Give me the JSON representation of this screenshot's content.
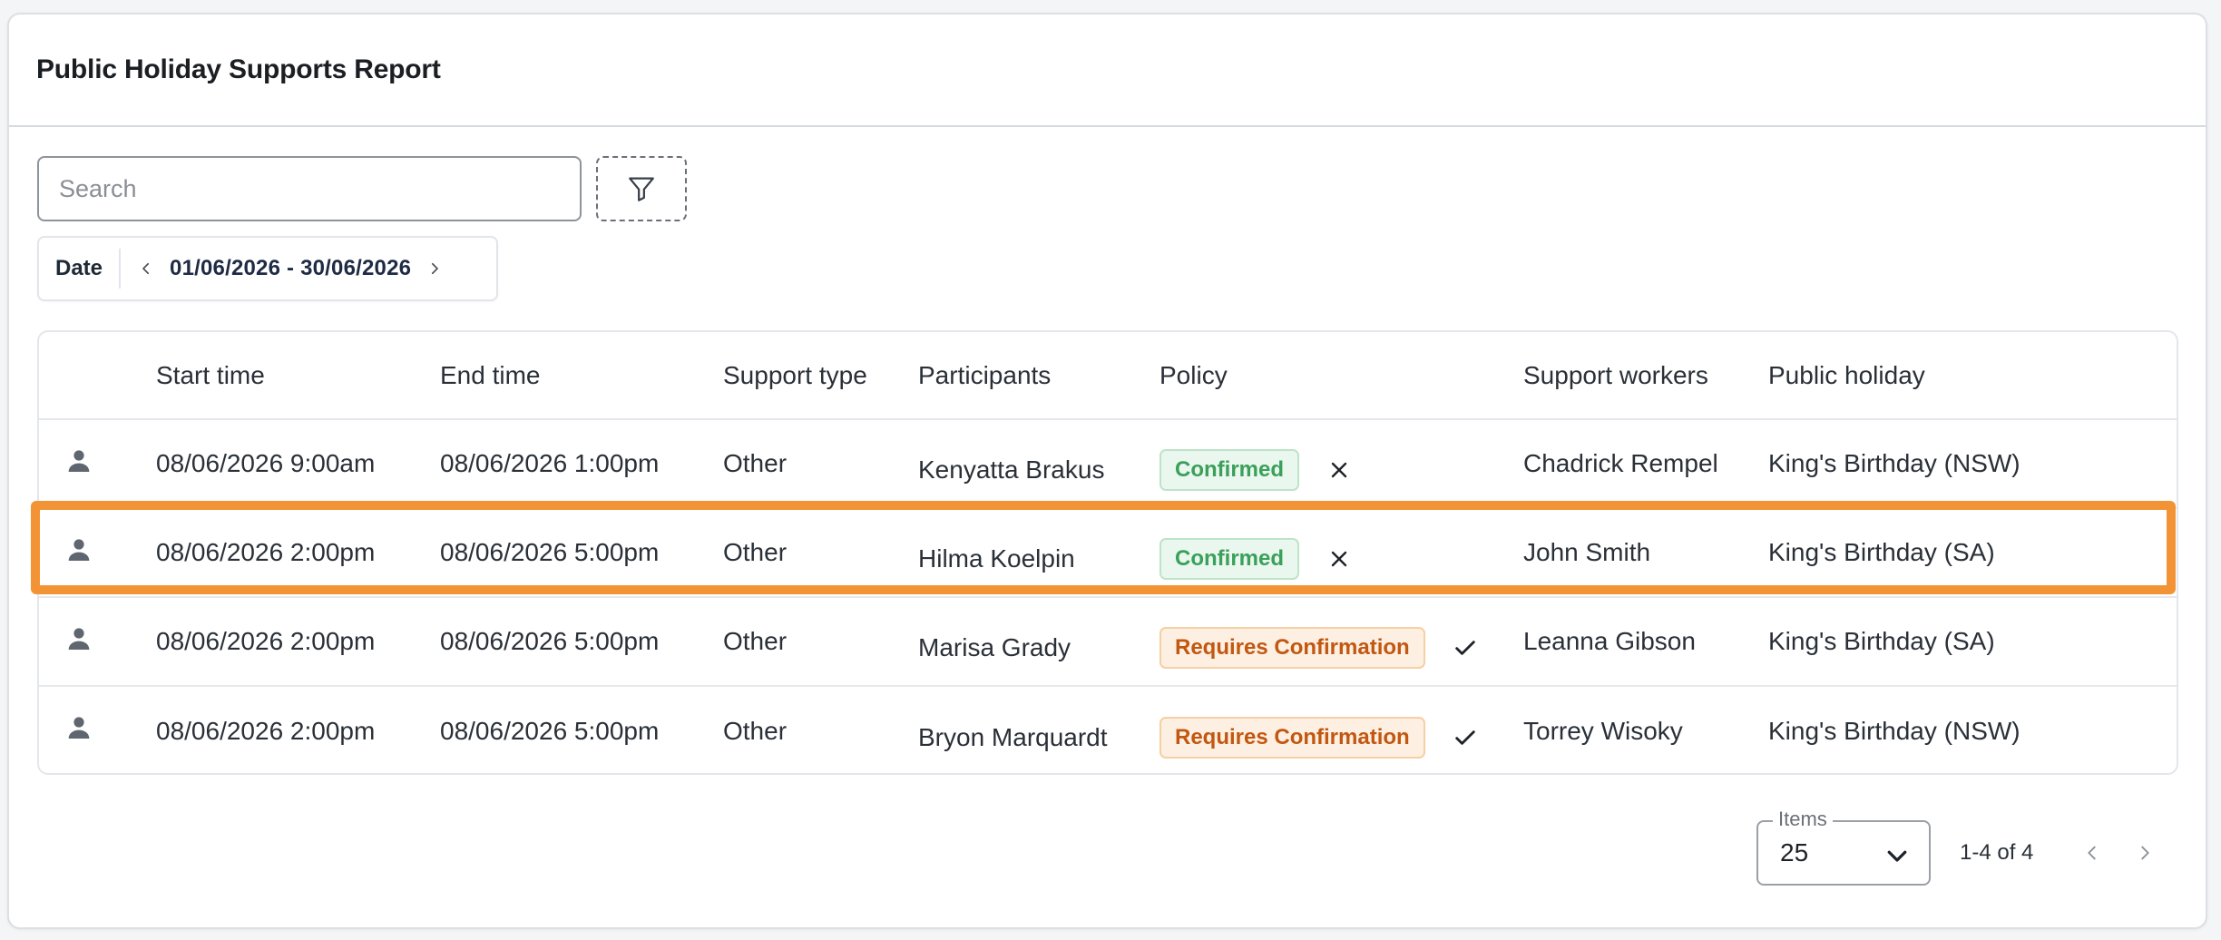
{
  "header": {
    "title": "Public Holiday Supports Report"
  },
  "toolbar": {
    "search_placeholder": "Search",
    "filter_icon": "filter-icon"
  },
  "date_filter": {
    "label": "Date",
    "range": "01/06/2026 - 30/06/2026"
  },
  "table": {
    "columns": [
      "Start time",
      "End time",
      "Support type",
      "Participants",
      "Policy",
      "Support workers",
      "Public holiday"
    ],
    "rows": [
      {
        "start": "08/06/2026 9:00am",
        "end": "08/06/2026 1:00pm",
        "type": "Other",
        "participant": "Kenyatta Brakus",
        "policy": "Confirmed",
        "action": "close-icon",
        "worker": "Chadrick Rempel",
        "holiday": "King's Birthday (NSW)"
      },
      {
        "start": "08/06/2026 2:00pm",
        "end": "08/06/2026 5:00pm",
        "type": "Other",
        "participant": "Hilma Koelpin",
        "policy": "Confirmed",
        "action": "close-icon",
        "worker": "John Smith",
        "holiday": "King's Birthday (SA)"
      },
      {
        "start": "08/06/2026 2:00pm",
        "end": "08/06/2026 5:00pm",
        "type": "Other",
        "participant": "Marisa Grady",
        "policy": "Requires Confirmation",
        "action": "check-icon",
        "worker": "Leanna Gibson",
        "holiday": "King's Birthday (SA)"
      },
      {
        "start": "08/06/2026 2:00pm",
        "end": "08/06/2026 5:00pm",
        "type": "Other",
        "participant": "Bryon Marquardt",
        "policy": "Requires Confirmation",
        "action": "check-icon",
        "worker": "Torrey Wisoky",
        "holiday": "King's Birthday (NSW)"
      }
    ]
  },
  "pagination": {
    "items_label": "Items",
    "items_value": "25",
    "range": "1-4 of 4"
  },
  "colors": {
    "highlight": "#f29436",
    "confirmed": "#3aa05a",
    "requires": "#c25711"
  }
}
